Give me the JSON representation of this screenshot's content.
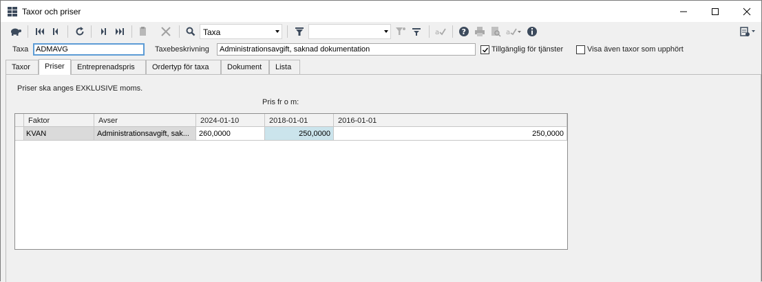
{
  "window": {
    "title": "Taxor och priser"
  },
  "toolbar": {
    "search_field_value": "Taxa",
    "filter_value": ""
  },
  "header": {
    "taxa_label": "Taxa",
    "taxa_value": "ADMAVG",
    "description_label": "Taxebeskrivning",
    "description_value": "Administrationsavgift, saknad dokumentation",
    "available_label": "Tillgänglig för tjänster",
    "available_checked": true,
    "show_expired_label": "Visa även taxor som upphört",
    "show_expired_checked": false
  },
  "tabs": [
    {
      "label": "Taxor"
    },
    {
      "label": "Priser"
    },
    {
      "label": "Entreprenadspris"
    },
    {
      "label": "Ordertyp för taxa"
    },
    {
      "label": "Dokument"
    },
    {
      "label": "Lista"
    }
  ],
  "active_tab": "Priser",
  "priser": {
    "note": "Priser ska anges EXKLUSIVE moms.",
    "price_from_label": "Pris fr o m:",
    "columns": [
      "Faktor",
      "Avser",
      "2024-01-10",
      "2018-01-01",
      "2016-01-01"
    ],
    "rows": [
      {
        "faktor": "KVAN",
        "avser": "Administrationsavgift, sak...",
        "p1": "260,0000",
        "p2": "250,0000",
        "p3": "250,0000"
      }
    ]
  },
  "colors": {
    "selected_cell": "#cbe4ec",
    "focus_border": "#5b9bd5",
    "icon_dark": "#3c4a5c"
  },
  "icons": [
    "app-grid-icon",
    "minimize-icon",
    "maximize-icon",
    "close-icon",
    "turtle-icon",
    "first-record-icon",
    "previous-record-icon",
    "refresh-icon",
    "next-record-icon",
    "last-record-icon",
    "paste-icon",
    "delete-icon",
    "search-icon",
    "filter-icon",
    "filter-settings-icon",
    "clear-filter-icon",
    "spellcheck-icon",
    "help-icon",
    "print-icon",
    "print-preview-icon",
    "sign-icon",
    "info-icon",
    "layout-settings-icon"
  ]
}
